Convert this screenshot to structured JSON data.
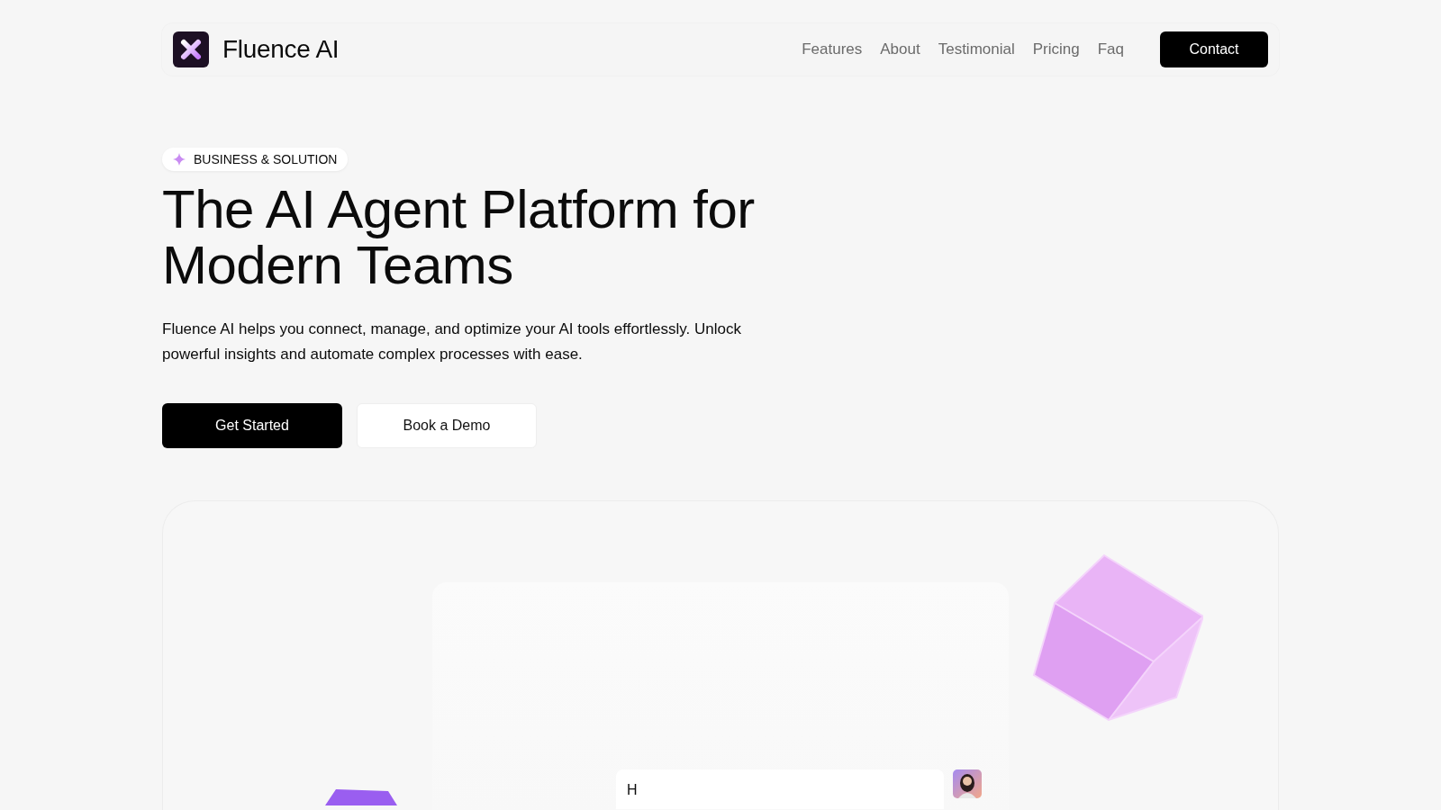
{
  "header": {
    "brand": "Fluence AI",
    "nav": [
      {
        "label": "Features"
      },
      {
        "label": "About"
      },
      {
        "label": "Testimonial"
      },
      {
        "label": "Pricing"
      },
      {
        "label": "Faq"
      }
    ],
    "cta": "Contact"
  },
  "hero": {
    "badge": "BUSINESS & SOLUTION",
    "title": "The AI Agent Platform for Modern Teams",
    "subtitle": "Fluence AI helps you connect, manage, and optimize your AI tools effortlessly. Unlock powerful insights and automate complex processes with ease.",
    "buttons": [
      {
        "label": "Get Started",
        "kind": "primary"
      },
      {
        "label": "Book a Demo",
        "kind": "secondary"
      }
    ]
  },
  "showcase": {
    "message": "H"
  }
}
